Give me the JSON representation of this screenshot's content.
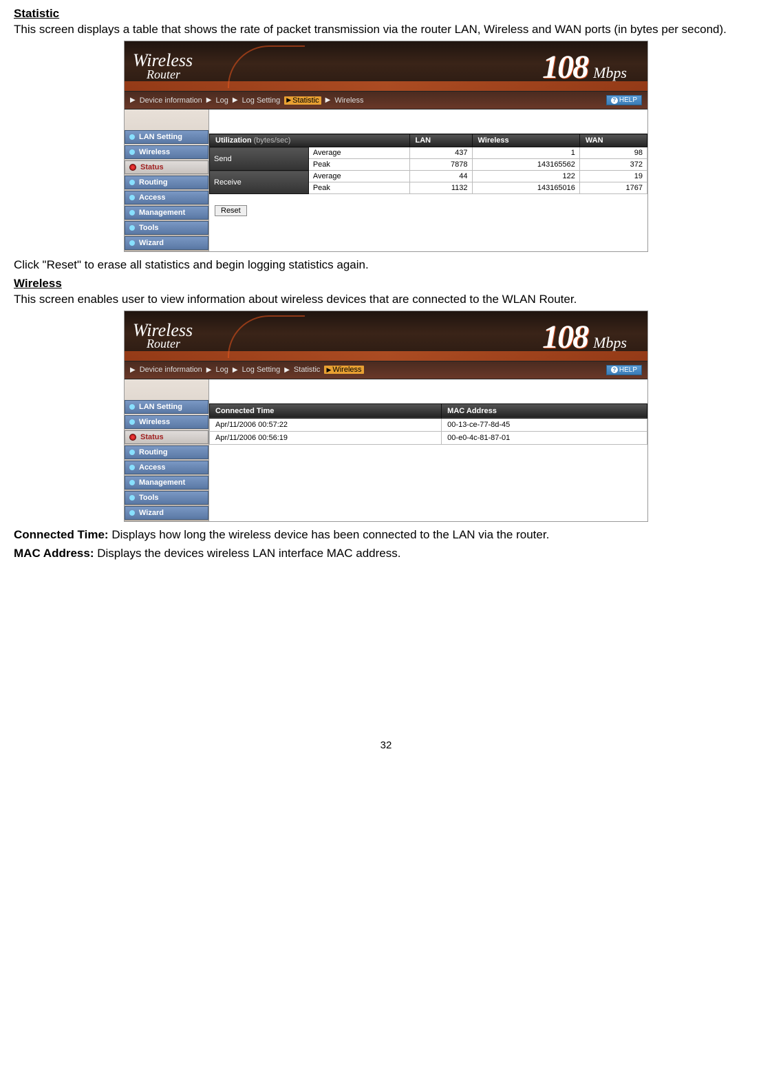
{
  "section1": {
    "heading": "Statistic",
    "text": "This screen displays a table that shows the rate of packet transmission via the router LAN, Wireless and WAN ports (in bytes per second).",
    "after": "Click \"Reset\" to erase all statistics and begin logging statistics again."
  },
  "section2": {
    "heading": "Wireless",
    "text": "This screen enables user to view information about wireless devices that are connected to the WLAN Router."
  },
  "def_conn": {
    "label": "Connected Time:",
    "text": " Displays how long the wireless device has been connected to the LAN via the router."
  },
  "def_mac": {
    "label": "MAC Address:",
    "text": " Displays the devices wireless LAN interface MAC address."
  },
  "router": {
    "logo_l1": "Wireless",
    "logo_l2": "Router",
    "mbps_num": "108",
    "mbps_unit": "Mbps",
    "help": "HELP",
    "crumbs": [
      "Device information",
      "Log",
      "Log Setting",
      "Statistic",
      "Wireless"
    ],
    "nav": [
      "LAN Setting",
      "Wireless",
      "Status",
      "Routing",
      "Access",
      "Management",
      "Tools",
      "Wizard"
    ],
    "active_nav": "Status"
  },
  "stat": {
    "header_util": "Utilization",
    "header_util_sub": "(bytes/sec)",
    "cols": [
      "LAN",
      "Wireless",
      "WAN"
    ],
    "groups": [
      "Send",
      "Receive"
    ],
    "subrows": [
      "Average",
      "Peak"
    ],
    "data": {
      "Send": {
        "Average": [
          "437",
          "1",
          "98"
        ],
        "Peak": [
          "7878",
          "143165562",
          "372"
        ]
      },
      "Receive": {
        "Average": [
          "44",
          "122",
          "19"
        ],
        "Peak": [
          "1132",
          "143165016",
          "1767"
        ]
      }
    },
    "reset": "Reset"
  },
  "conn": {
    "headers": [
      "Connected Time",
      "MAC Address"
    ],
    "rows": [
      [
        "Apr/11/2006 00:57:22",
        "00-13-ce-77-8d-45"
      ],
      [
        "Apr/11/2006 00:56:19",
        "00-e0-4c-81-87-01"
      ]
    ]
  },
  "page_number": "32"
}
